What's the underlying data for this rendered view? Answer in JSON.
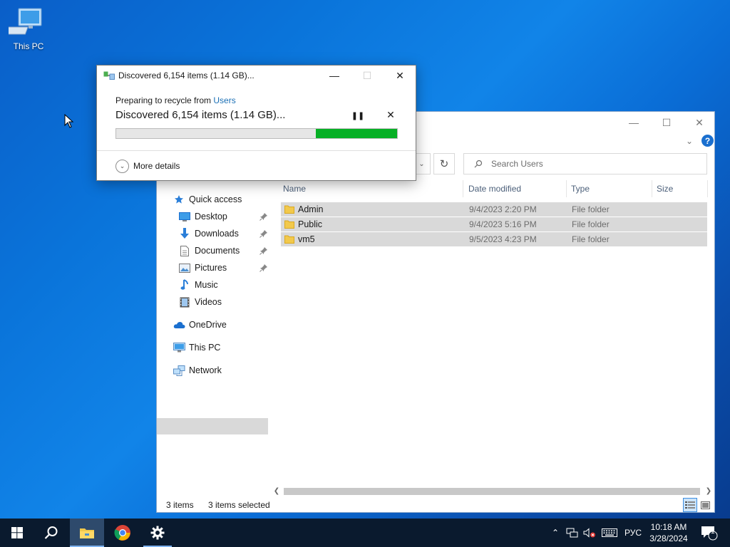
{
  "desktop": {
    "icon_label": "This PC"
  },
  "dialog": {
    "title": "Discovered 6,154 items (1.14 GB)...",
    "subtitle_prefix": "Preparing to recycle from ",
    "subtitle_link": "Users",
    "main_status": "Discovered 6,154 items (1.14 GB)...",
    "progress_fraction": 0.71,
    "more_details_label": "More details"
  },
  "explorer": {
    "search_placeholder": "Search Users",
    "nav": {
      "quick_access": "Quick access",
      "desktop": "Desktop",
      "downloads": "Downloads",
      "documents": "Documents",
      "pictures": "Pictures",
      "music": "Music",
      "videos": "Videos",
      "onedrive": "OneDrive",
      "this_pc": "This PC",
      "network": "Network"
    },
    "columns": {
      "name": "Name",
      "date": "Date modified",
      "type": "Type",
      "size": "Size"
    },
    "rows": [
      {
        "name": "Admin",
        "date": "9/4/2023 2:20 PM",
        "type": "File folder"
      },
      {
        "name": "Public",
        "date": "9/4/2023 5:16 PM",
        "type": "File folder"
      },
      {
        "name": "vm5",
        "date": "9/5/2023 4:23 PM",
        "type": "File folder"
      }
    ],
    "status_count": "3 items",
    "status_selected": "3 items selected"
  },
  "taskbar": {
    "language": "РУС",
    "time": "10:18 AM",
    "date": "3/28/2024",
    "notification_count": "1"
  },
  "colors": {
    "progress": "#06b025",
    "accent": "#1a6fcf",
    "selection": "#d9d9d9"
  }
}
